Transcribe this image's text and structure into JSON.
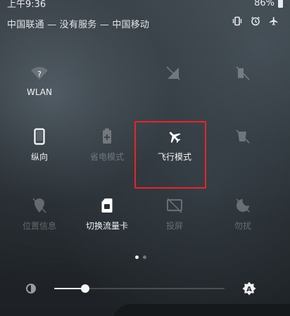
{
  "status_bar": {
    "time": "上午9:36",
    "battery": "86%",
    "carrier_line": "中国联通 — 没有服务 — 中国移动",
    "icons": [
      "vibrate-icon",
      "alarm-icon",
      "airplane-icon"
    ]
  },
  "tiles": [
    {
      "name": "wlan",
      "label": "WLAN",
      "state": "on",
      "icon": "wifi-question-icon"
    },
    {
      "name": "tile-2",
      "label": "",
      "state": "off",
      "icon": "data-off-icon"
    },
    {
      "name": "tile-3",
      "label": "",
      "state": "off",
      "icon": "phone-off-icon"
    },
    {
      "name": "portrait",
      "label": "纵向",
      "state": "on",
      "icon": "phone-portrait-icon"
    },
    {
      "name": "battery-saver",
      "label": "省电模式",
      "state": "off",
      "icon": "battery-saver-icon"
    },
    {
      "name": "airplane-mode",
      "label": "飞行模式",
      "state": "on",
      "icon": "airplane-icon"
    },
    {
      "name": "tile-6",
      "label": "",
      "state": "off",
      "icon": "location-off-icon"
    },
    {
      "name": "location",
      "label": "位置信息",
      "state": "off",
      "icon": "location-off-icon"
    },
    {
      "name": "switch-data-card",
      "label": "切换流量卡",
      "state": "on",
      "icon": "sim-card-icon"
    },
    {
      "name": "screencast",
      "label": "投屏",
      "state": "off",
      "icon": "cast-off-icon"
    },
    {
      "name": "dnd",
      "label": "勿扰",
      "state": "off",
      "icon": "dnd-off-icon"
    }
  ],
  "page_indicator": {
    "current": 1,
    "total": 2
  },
  "brightness": {
    "level": 0.18,
    "auto_label": "A"
  },
  "colors": {
    "highlight": "#e8242a",
    "tile_on": "#f2f4f5"
  }
}
